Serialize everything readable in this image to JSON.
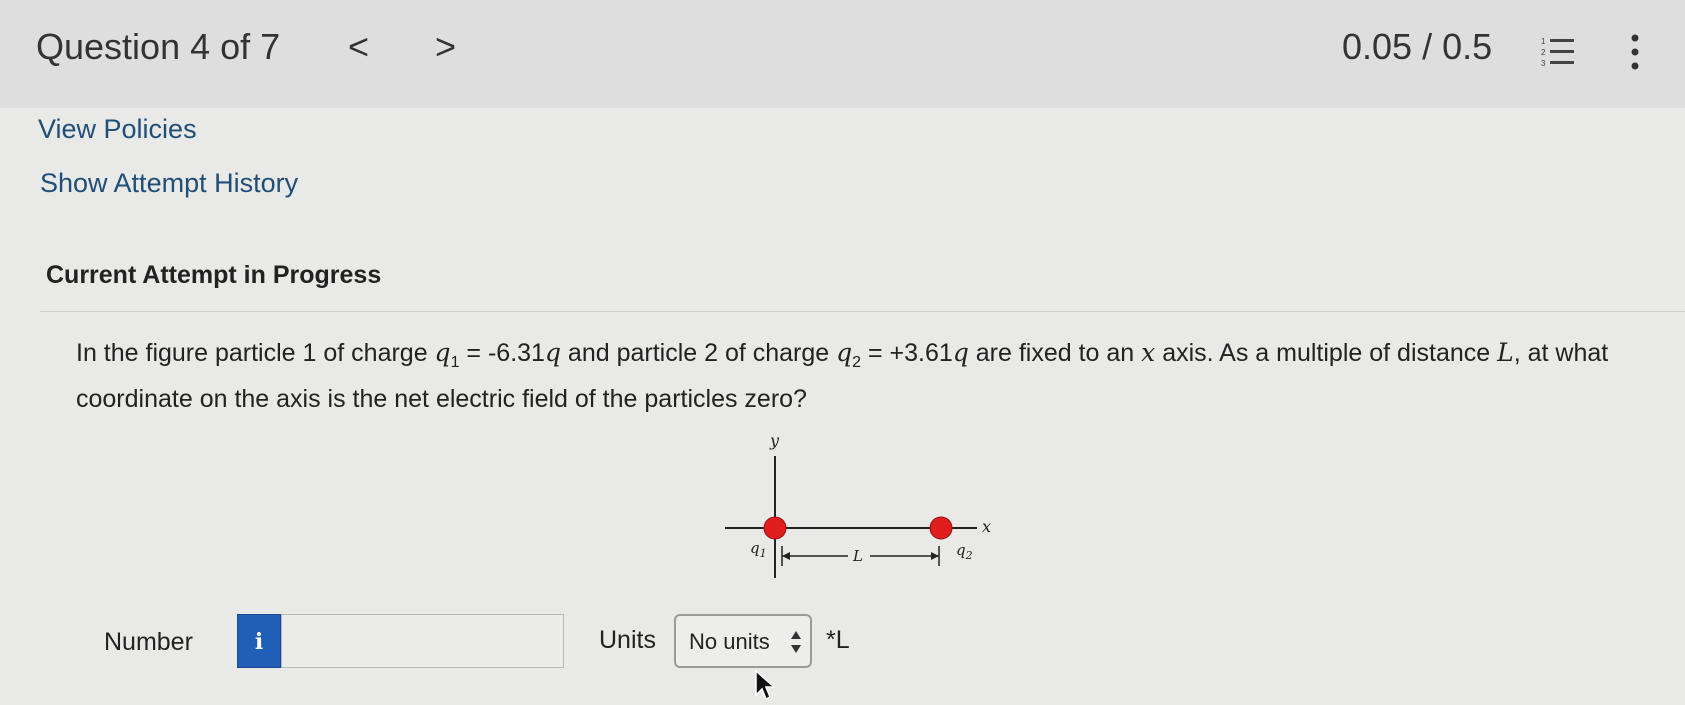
{
  "header": {
    "title": "Question 4 of 7",
    "prev_label": "<",
    "next_label": ">",
    "score": "0.05 / 0.5",
    "list_icon": "numbered-list-icon",
    "menu_icon": "more-vert-icon"
  },
  "links": {
    "view_policies": "View Policies",
    "attempt_history": "Show Attempt History"
  },
  "section": {
    "heading": "Current Attempt in Progress"
  },
  "question": {
    "text_1": "In the figure particle 1 of charge ",
    "q1_symbol": "q",
    "q1_sub": "1",
    "text_2": " = -6.31",
    "q_a": "q",
    "text_3": " and particle 2 of charge ",
    "q2_symbol": "q",
    "q2_sub": "2",
    "text_4": " = +3.61",
    "q_b": "q",
    "text_5": " are fixed to an ",
    "x_var": "x",
    "text_6": " axis. As a multiple of distance ",
    "L_var": "L",
    "text_7": ", at what coordinate on the axis is the net electric field of the particles zero?"
  },
  "figure": {
    "y_label": "y",
    "x_label": "x",
    "q1_label": "q",
    "q1_sub": "1",
    "q2_label": "q",
    "q2_sub": "2",
    "distance_label": "L",
    "particle_color": "#e01e1e"
  },
  "answer": {
    "number_label": "Number",
    "info_label": "i",
    "number_value": "",
    "units_label": "Units",
    "units_selected": "No units",
    "units_suffix": "*L"
  },
  "colors": {
    "link": "#1f4e78",
    "info_button": "#1f5fb7"
  }
}
